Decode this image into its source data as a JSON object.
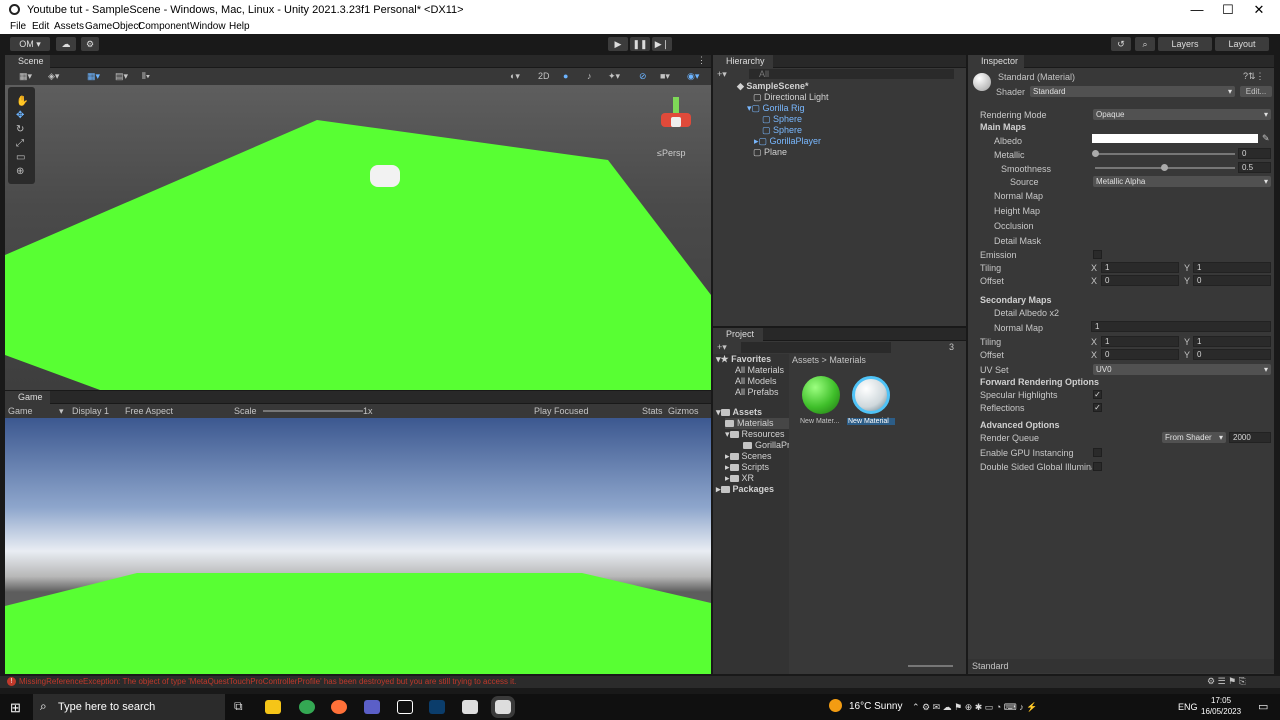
{
  "window": {
    "title": "Youtube tut - SampleScene - Windows, Mac, Linux - Unity 2021.3.23f1 Personal* <DX11>",
    "minimize": "—",
    "maximize": "☐",
    "close": "✕"
  },
  "menu": [
    "File",
    "Edit",
    "Assets",
    "GameObject",
    "Component",
    "Window",
    "Help"
  ],
  "toolbar": {
    "account": "OM ▾",
    "layers": "Layers",
    "layout": "Layout"
  },
  "scene": {
    "tab": "Scene",
    "mode2d": "2D",
    "persp": "≤Persp"
  },
  "game": {
    "tab": "Game",
    "view_select": "Game",
    "display": "Display 1",
    "aspect": "Free Aspect",
    "scale_label": "Scale",
    "scale_value": "1x",
    "play_focused": "Play Focused",
    "stats": "Stats",
    "gizmos": "Gizmos"
  },
  "hierarchy": {
    "tab": "Hierarchy",
    "search_placeholder": "All",
    "items": [
      "SampleScene*",
      "Directional Light",
      "Gorilla Rig",
      "Sphere",
      "Sphere",
      "GorillaPlayer",
      "Plane"
    ]
  },
  "project": {
    "tab": "Project",
    "badge": "3",
    "breadcrumb_root": "Assets",
    "breadcrumb_sep": ">",
    "breadcrumb_leaf": "Materials",
    "tree": [
      "Favorites",
      "All Materials",
      "All Models",
      "All Prefabs",
      "Assets",
      "Materials",
      "Resources",
      "GorillaPr",
      "Scenes",
      "Scripts",
      "XR",
      "Packages"
    ],
    "assets": [
      {
        "name": "New Mater...",
        "color": "#3fbf2a"
      },
      {
        "name": "New Material",
        "color": "#4fc3f7"
      }
    ]
  },
  "inspector": {
    "tab": "Inspector",
    "title": "Standard (Material)",
    "shader_label": "Shader",
    "shader_value": "Standard",
    "edit_button": "Edit...",
    "rendering_mode_label": "Rendering Mode",
    "rendering_mode_value": "Opaque",
    "main_maps": "Main Maps",
    "albedo": "Albedo",
    "metallic": "Metallic",
    "metallic_value": "0",
    "smoothness": "Smoothness",
    "smoothness_value": "0.5",
    "source": "Source",
    "source_value": "Metallic Alpha",
    "normal_map": "Normal Map",
    "height_map": "Height Map",
    "occlusion": "Occlusion",
    "detail_mask": "Detail Mask",
    "emission": "Emission",
    "tiling": "Tiling",
    "offset": "Offset",
    "x": "X",
    "y": "Y",
    "tiling_x": "1",
    "tiling_y": "1",
    "offset_x": "0",
    "offset_y": "0",
    "secondary_maps": "Secondary Maps",
    "detail_albedo": "Detail Albedo x2",
    "normal_map2": "Normal Map",
    "normal_map2_value": "1",
    "tiling2_x": "1",
    "tiling2_y": "1",
    "offset2_x": "0",
    "offset2_y": "0",
    "uv_set": "UV Set",
    "uv_set_value": "UV0",
    "forward_options": "Forward Rendering Options",
    "specular_highlights": "Specular Highlights",
    "reflections": "Reflections",
    "advanced_options": "Advanced Options",
    "render_queue": "Render Queue",
    "render_queue_mode": "From Shader",
    "render_queue_value": "2000",
    "gpu_instancing": "Enable GPU Instancing",
    "double_sided": "Double Sided Global Illuminati",
    "footer": "Standard"
  },
  "console": {
    "error": "MissingReferenceException: The object of type 'MetaQuestTouchProControllerProfile' has been destroyed but you are still trying to access it."
  },
  "taskbar": {
    "search_placeholder": "Type here to search",
    "weather": "16°C  Sunny",
    "lang": "ENG",
    "time": "17:05",
    "date": "16/05/2023"
  },
  "colors": {
    "ground": "#58ff33",
    "sky_top": "#4a5b8a",
    "error": "#c0392b"
  }
}
